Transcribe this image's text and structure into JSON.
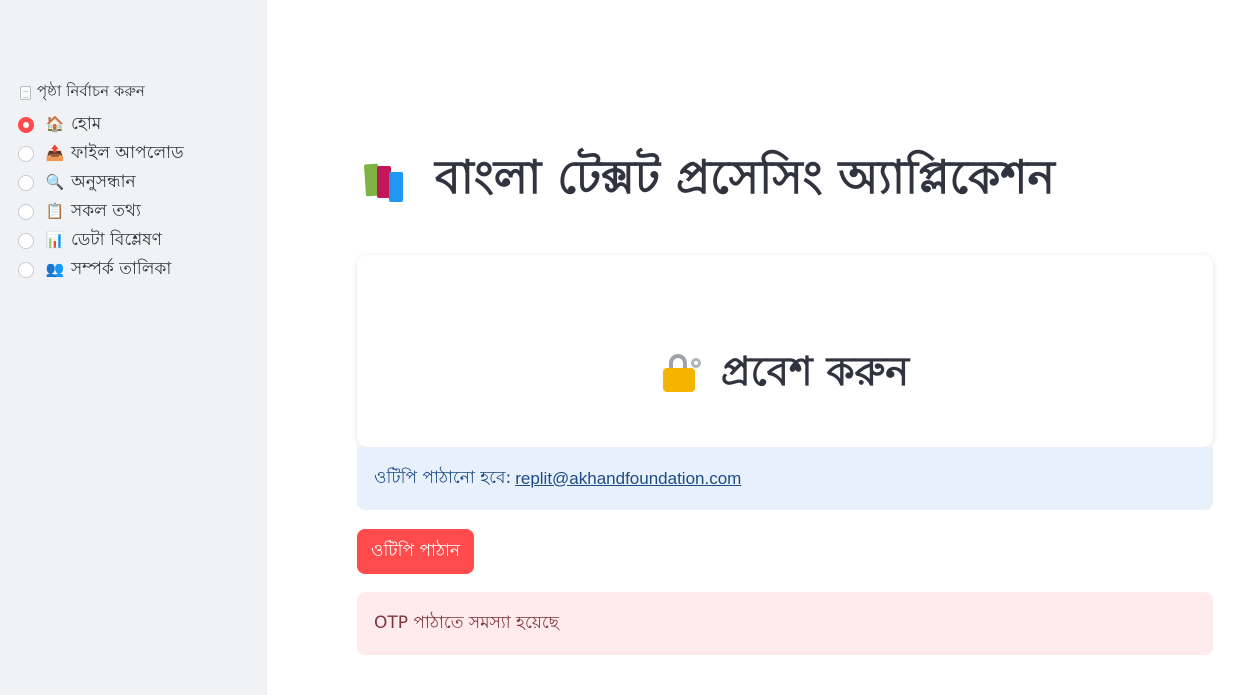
{
  "sidebar": {
    "caption": "পৃষ্ঠা নির্বাচন করুন",
    "caption_icon": "page-icon",
    "selected_index": 0,
    "items": [
      {
        "emoji": "🏠",
        "label": "হোম",
        "icon": "house-icon"
      },
      {
        "emoji": "📤",
        "label": "ফাইল আপলোড",
        "icon": "upload-tray-icon"
      },
      {
        "emoji": "🔍",
        "label": "অনুসন্ধান",
        "icon": "magnifier-icon"
      },
      {
        "emoji": "📋",
        "label": "সকল তথ্য",
        "icon": "clipboard-icon"
      },
      {
        "emoji": "📊",
        "label": "ডেটা বিশ্লেষণ",
        "icon": "bar-chart-icon"
      },
      {
        "emoji": "👥",
        "label": "সম্পর্ক তালিকা",
        "icon": "people-icon"
      }
    ]
  },
  "main": {
    "title": "বাংলা টেক্সট প্রসেসিং অ্যাপ্লিকেশন",
    "title_icon": "books-icon",
    "login": {
      "heading": "প্রবেশ করুন",
      "heading_icon": "lock-with-key-icon"
    },
    "info": {
      "prefix": "ওটিপি পাঠানো হবে:",
      "email": "replit@akhandfoundation.com"
    },
    "otp_button_label": "ওটিপি পাঠান",
    "error_message": "OTP পাঠাতে সমস্যা হয়েছে"
  },
  "colors": {
    "accent": "#ff4b4b",
    "sidebar_bg": "#f0f2f6",
    "info_bg": "#e8f0fb",
    "info_text": "#1c4b86",
    "error_bg": "#ffebeb",
    "error_text": "#7d353b"
  }
}
